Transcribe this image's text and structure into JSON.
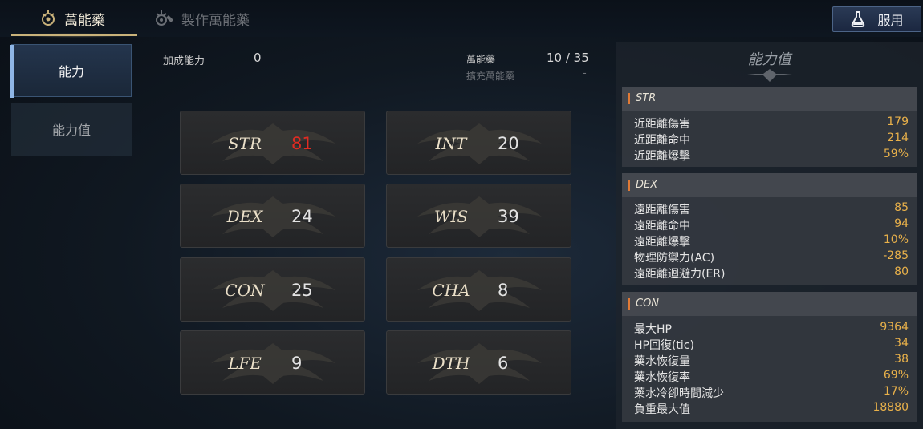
{
  "tabs": [
    {
      "label": "萬能藥",
      "icon": "elixir-crest-icon",
      "active": true
    },
    {
      "label": "製作萬能藥",
      "icon": "crafting-crest-icon",
      "active": false
    }
  ],
  "use_button": {
    "label": "服用",
    "icon": "potion-flask-icon"
  },
  "nav": {
    "items": [
      {
        "label": "能力",
        "active": true
      },
      {
        "label": "能力值",
        "active": false
      }
    ]
  },
  "summary": {
    "bonus_label": "加成能力",
    "bonus_value": "0",
    "elixir_label": "萬能藥",
    "elixir_value": "10 / 35",
    "expand_label": "擴充萬能藥",
    "expand_value": "-"
  },
  "stats": [
    {
      "name": "STR",
      "value": "81",
      "highlight": true
    },
    {
      "name": "INT",
      "value": "20"
    },
    {
      "name": "DEX",
      "value": "24"
    },
    {
      "name": "WIS",
      "value": "39"
    },
    {
      "name": "CON",
      "value": "25"
    },
    {
      "name": "CHA",
      "value": "8"
    },
    {
      "name": "LFE",
      "value": "9"
    },
    {
      "name": "DTH",
      "value": "6"
    }
  ],
  "panel": {
    "title": "能力值",
    "sections": [
      {
        "name": "STR",
        "rows": [
          {
            "label": "近距離傷害",
            "value": "179"
          },
          {
            "label": "近距離命中",
            "value": "214"
          },
          {
            "label": "近距離爆擊",
            "value": "59%"
          }
        ]
      },
      {
        "name": "DEX",
        "rows": [
          {
            "label": "遠距離傷害",
            "value": "85"
          },
          {
            "label": "遠距離命中",
            "value": "94"
          },
          {
            "label": "遠距離爆擊",
            "value": "10%"
          },
          {
            "label": "物理防禦力(AC)",
            "value": "-285"
          },
          {
            "label": "遠距離迴避力(ER)",
            "value": "80"
          }
        ]
      },
      {
        "name": "CON",
        "rows": [
          {
            "label": "最大HP",
            "value": "9364"
          },
          {
            "label": "HP回復(tic)",
            "value": "34"
          },
          {
            "label": "藥水恢復量",
            "value": "38"
          },
          {
            "label": "藥水恢復率",
            "value": "69%"
          },
          {
            "label": "藥水冷卻時間減少",
            "value": "17%"
          },
          {
            "label": "負重最大值",
            "value": "18880"
          }
        ]
      }
    ]
  },
  "colors": {
    "accent_gold": "#c9b27a",
    "highlight_red": "#e02b22",
    "value_orange": "#e9b14a",
    "section_bar": "#e07a36"
  }
}
